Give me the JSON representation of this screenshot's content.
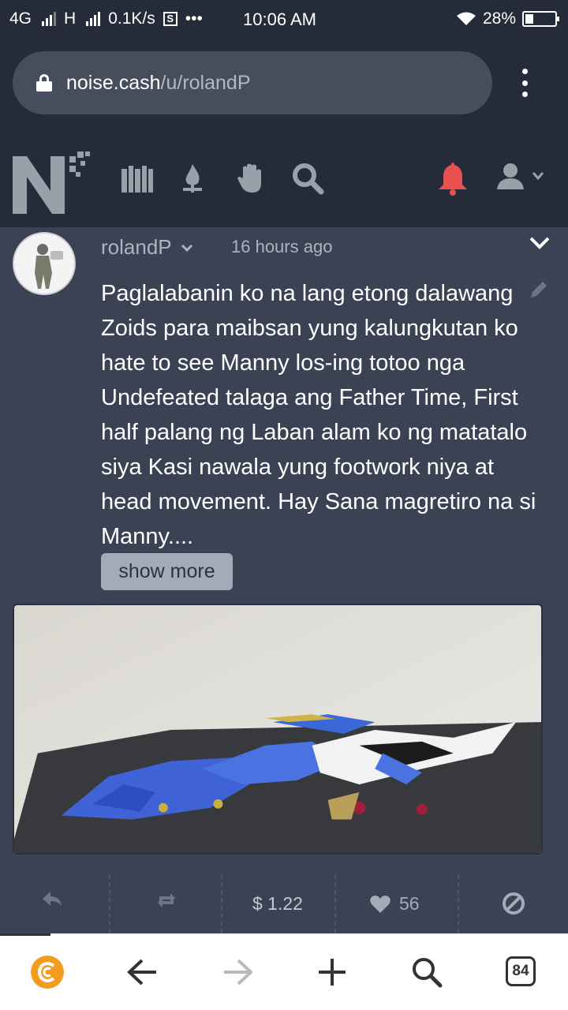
{
  "status_bar": {
    "network": "4G",
    "network2": "H",
    "speed": "0.1K/s",
    "s_badge": "S",
    "dots": "•••",
    "time": "10:06 AM",
    "battery": "28%"
  },
  "browser": {
    "url_domain": "noise.cash",
    "url_path": "/u/rolandP",
    "tab_count": "84"
  },
  "nav": {
    "icons": [
      "library-icon",
      "flame-icon",
      "hand-icon",
      "search-icon",
      "bell-icon",
      "user-icon"
    ],
    "bell_color": "#e8514f"
  },
  "post": {
    "author": "rolandP",
    "time_ago": "16 hours ago",
    "text": "Paglalabanin ko na lang etong dalawang Zoids para maibsan yung kalungkutan ko hate to see Manny los-ing totoo nga Undefeated talaga ang Father Time, First half palang ng Laban alam ko ng matatalo siya Kasi nawala yung footwork niya at head movement. Hay Sana magretiro na si Manny....",
    "show_more": "show more",
    "amount": "$ 1.22",
    "likes": "56"
  },
  "colors": {
    "background": "#3a4254",
    "header": "#252b38",
    "accent_browser": "#f39c1f"
  }
}
